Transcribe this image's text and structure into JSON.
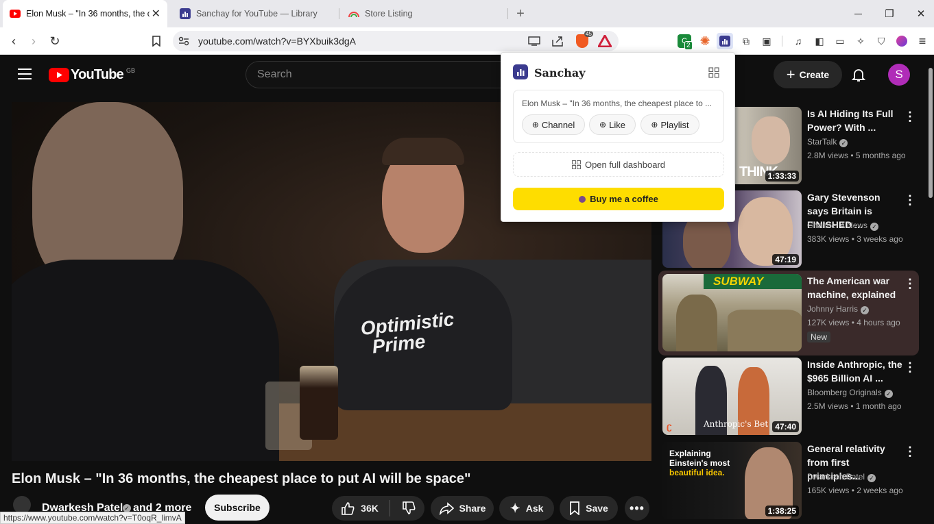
{
  "browser": {
    "tabs": [
      {
        "title": "Elon Musk – \"In 36 months, the c",
        "active": true
      },
      {
        "title": "Sanchay for YouTube — Library",
        "active": false
      },
      {
        "title": "Store Listing",
        "active": false
      }
    ],
    "new_tab": "+",
    "window_controls": {
      "minimize": "—",
      "maximize": "❐",
      "close": "✕"
    },
    "url": "youtube.com/watch?v=BYXbuik3dgA",
    "extension_badges": {
      "brave": "45",
      "sanchay_count": "2"
    },
    "status_url": "https://www.youtube.com/watch?v=T0oqR_limvA"
  },
  "youtube": {
    "logo_text": "YouTube",
    "region": "GB",
    "search_placeholder": "Search",
    "create_label": "Create",
    "avatar_letter": "S",
    "video_title": "Elon Musk – \"In 36 months, the cheapest place to put AI will be space\"",
    "channel_name": "Dwarkesh Patel",
    "channel_suffix": "and 2 more",
    "subscribe_label": "Subscribe",
    "like_count": "36K",
    "share_label": "Share",
    "ask_label": "Ask",
    "save_label": "Save",
    "shirt_text_1": "Optimistic",
    "shirt_text_2": "Prime",
    "sidebar": [
      {
        "title": "Is AI Hiding Its Full Power? With ...",
        "channel": "StarTalk",
        "meta": "2.8M views • 5 months ago",
        "duration": "1:33:33",
        "badge": "",
        "thumb_text": "THINK"
      },
      {
        "title": "Gary Stevenson says Britain is FINISHED ...",
        "channel": "Channel 4 News",
        "meta": "383K views • 3 weeks ago",
        "duration": "47:19",
        "badge": "",
        "thumb_text": ""
      },
      {
        "title": "The American war machine, explained",
        "channel": "Johnny Harris",
        "meta": "127K views • 4 hours ago",
        "duration": "",
        "badge": "New",
        "thumb_text": "SUBWAY"
      },
      {
        "title": "Inside Anthropic, the $965 Billion AI ...",
        "channel": "Bloomberg Originals",
        "meta": "2.5M views • 1 month ago",
        "duration": "47:40",
        "badge": "",
        "thumb_text": "Anthropic's Bet"
      },
      {
        "title": "General relativity from first principles...",
        "channel": "Dwarkesh Patel",
        "meta": "165K views • 2 weeks ago",
        "duration": "1:38:25",
        "badge": "",
        "thumb_text": "Explaining Einstein's most",
        "thumb_text2": "beautiful idea."
      }
    ]
  },
  "sanchay": {
    "title": "Sanchay",
    "video_title": "Elon Musk – \"In 36 months, the cheapest place to ...",
    "actions": [
      "Channel",
      "Like",
      "Playlist"
    ],
    "dashboard_label": "Open full dashboard",
    "coffee_label": "Buy me a coffee"
  }
}
